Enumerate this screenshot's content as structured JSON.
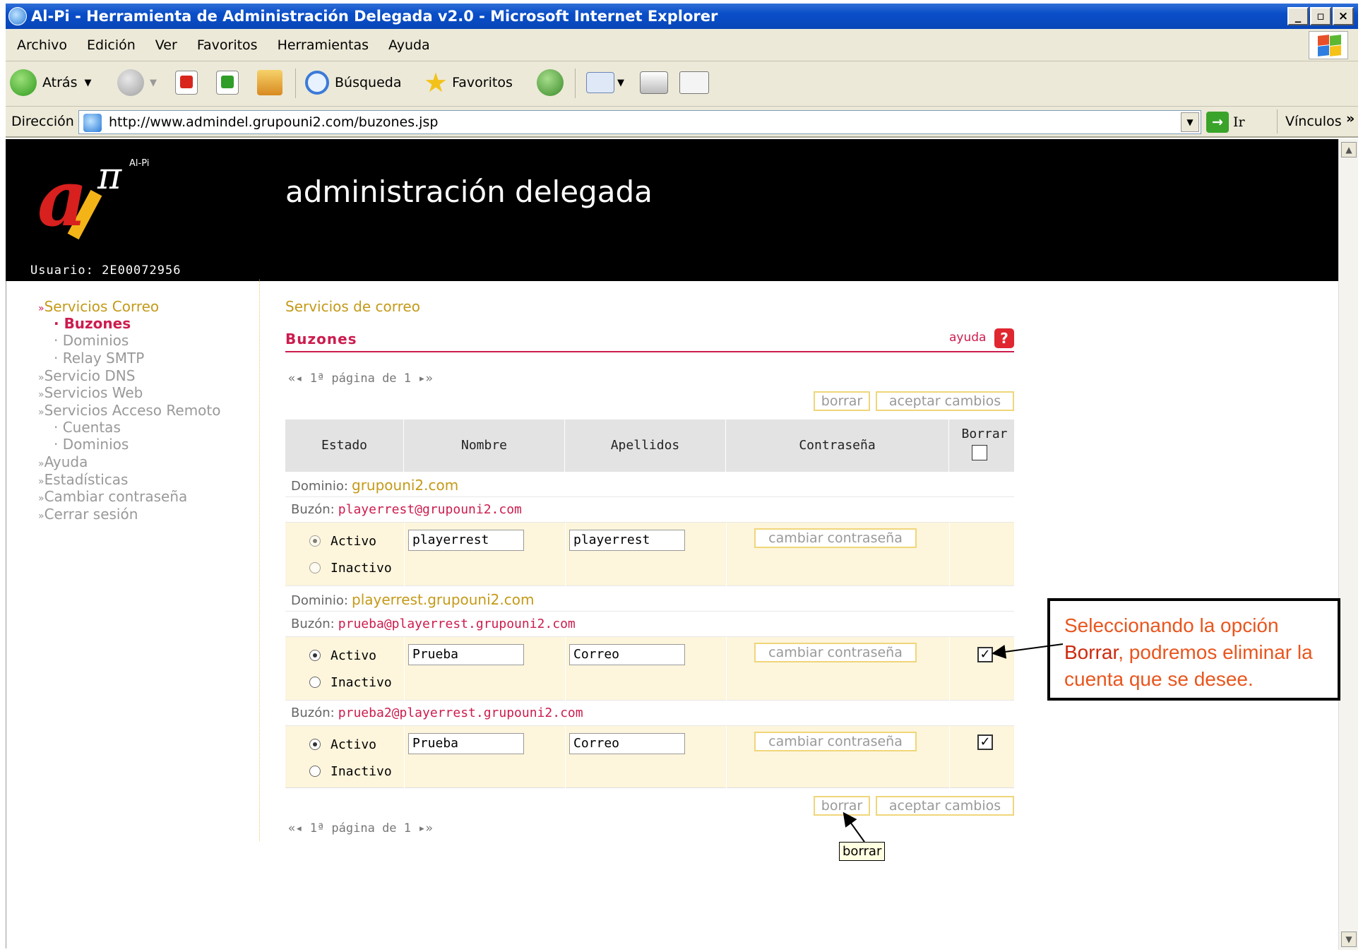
{
  "window": {
    "title": "Al-Pi - Herramienta de Administración Delegada v2.0 - Microsoft Internet Explorer",
    "minimize": "_",
    "restore": "▫",
    "close": "×"
  },
  "menu": [
    "Archivo",
    "Edición",
    "Ver",
    "Favoritos",
    "Herramientas",
    "Ayuda"
  ],
  "toolbar": {
    "back": "Atrás",
    "search": "Búsqueda",
    "favorites": "Favoritos"
  },
  "address": {
    "label": "Dirección",
    "url": "http://www.admindel.grupouni2.com/buzones.jsp",
    "go": "Ir",
    "links": "Vínculos"
  },
  "header": {
    "logo_small": "Al-Pi",
    "logo_pi": "π",
    "title": "administración delegada",
    "user": "Usuario: 2E00072956"
  },
  "sidebar": {
    "items": [
      {
        "label": "Servicios Correo",
        "level": 0,
        "active": true
      },
      {
        "label": "Buzones",
        "level": 1,
        "active": true
      },
      {
        "label": "Dominios",
        "level": 1,
        "active": false
      },
      {
        "label": "Relay SMTP",
        "level": 1,
        "active": false
      },
      {
        "label": "Servicio DNS",
        "level": 0,
        "active": false
      },
      {
        "label": "Servicios Web",
        "level": 0,
        "active": false
      },
      {
        "label": "Servicios Acceso Remoto",
        "level": 0,
        "active": false
      },
      {
        "label": "Cuentas",
        "level": 1,
        "active": false
      },
      {
        "label": "Dominios",
        "level": 1,
        "active": false
      },
      {
        "label": "Ayuda",
        "level": 0,
        "active": false
      },
      {
        "label": "Estadísticas",
        "level": 0,
        "active": false
      },
      {
        "label": "Cambiar contraseña",
        "level": 0,
        "active": false
      },
      {
        "label": "Cerrar sesión",
        "level": 0,
        "active": false
      }
    ]
  },
  "main": {
    "breadcrumb": "Servicios de correo",
    "heading": "Buzones",
    "help": "ayuda",
    "help_icon": "?",
    "pagination": "1ª página de 1",
    "btn_delete": "borrar",
    "btn_accept": "aceptar cambios",
    "columns": [
      "Estado",
      "Nombre",
      "Apellidos",
      "Contraseña",
      "Borrar"
    ],
    "domain_label": "Dominio:",
    "mailbox_label": "Buzón:",
    "active_label": "Activo",
    "inactive_label": "Inactivo",
    "change_pwd": "cambiar contraseña",
    "groups": [
      {
        "domain": "grupouni2.com",
        "mailboxes": [
          {
            "address": "playerrest@grupouni2.com",
            "nombre": "playerrest",
            "apellidos": "playerrest",
            "activo": true,
            "borrar": null
          }
        ]
      },
      {
        "domain": "playerrest.grupouni2.com",
        "mailboxes": [
          {
            "address": "prueba@playerrest.grupouni2.com",
            "nombre": "Prueba",
            "apellidos": "Correo",
            "activo": true,
            "borrar": true
          },
          {
            "address": "prueba2@playerrest.grupouni2.com",
            "nombre": "Prueba",
            "apellidos": "Correo",
            "activo": true,
            "borrar": true
          }
        ]
      }
    ],
    "tooltip": "borrar"
  },
  "callout": {
    "pre": "Seleccionando la opción ",
    "bold": "Borrar",
    "post": ", podremos eliminar la cuenta que se desee."
  },
  "colors": {
    "accent": "#cc1c4e",
    "gold": "#c49a18",
    "header_bg": "#000000",
    "row_bg": "#fdf5dc",
    "table_head": "#e3e3e3",
    "callout": "#e8561e"
  }
}
